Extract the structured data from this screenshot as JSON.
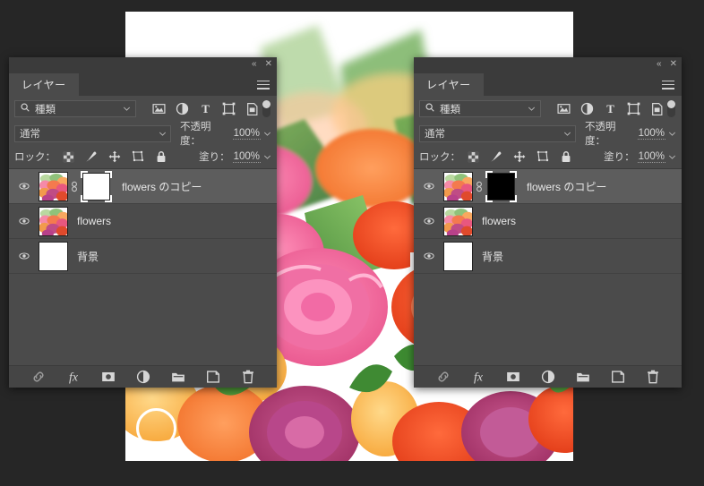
{
  "app": {
    "background_color": "#262626",
    "panel_bg": "#4b4b4b",
    "panel_header_bg": "#3b3b3b",
    "selected_row_bg": "#5d5d5d",
    "highlight_ring_color": "#ffffff"
  },
  "canvas": {
    "name": "flower-bouquet-photo",
    "description": "花束の写真",
    "arrow": "➡"
  },
  "panels": [
    {
      "id": "left",
      "titlebar": {
        "collapse": "«",
        "close": "✕"
      },
      "tab": {
        "label": "レイヤー",
        "menu_icon": "hamburger-icon"
      },
      "filter": {
        "search_icon": "search-icon",
        "kind_label": "種類",
        "chevron": "chevron-down-icon",
        "icons": [
          "image-filter-icon",
          "adjustment-filter-icon",
          "type-filter-icon",
          "shape-filter-icon",
          "smart-object-filter-icon"
        ],
        "toggle": "filter-toggle"
      },
      "blend": {
        "mode": "通常",
        "chevron": "chevron-down-icon",
        "opacity_label": "不透明度：",
        "opacity_value": "100%"
      },
      "lock": {
        "label": "ロック：",
        "icons": [
          "lock-transparency-icon",
          "lock-image-icon",
          "lock-position-icon",
          "lock-artboard-icon",
          "lock-all-icon"
        ],
        "fill_label": "塗り：",
        "fill_value": "100%"
      },
      "layers": [
        {
          "name": "flowers のコピー",
          "visible_icon": "eye-icon",
          "selected": true,
          "thumb": "photo",
          "has_link": true,
          "link_icon": "link-icon",
          "mask": {
            "present": true,
            "fill": "#ffffff",
            "selected": true
          }
        },
        {
          "name": "flowers",
          "visible_icon": "eye-icon",
          "selected": false,
          "thumb": "photo",
          "has_link": false,
          "mask": {
            "present": false
          }
        },
        {
          "name": "背景",
          "visible_icon": "eye-icon",
          "selected": false,
          "thumb": "white",
          "has_link": false,
          "mask": {
            "present": false
          }
        }
      ],
      "toolbar": [
        {
          "icon": "link-layers-icon",
          "label": "レイヤーをリンク",
          "highlighted": false
        },
        {
          "icon": "fx-icon",
          "label": "fx",
          "highlighted": false
        },
        {
          "icon": "add-layer-mask-icon",
          "label": "レイヤーマスクを追加",
          "highlighted": true
        },
        {
          "icon": "adjustment-layer-icon",
          "label": "調整レイヤー",
          "highlighted": false
        },
        {
          "icon": "new-group-icon",
          "label": "新規グループ",
          "highlighted": false
        },
        {
          "icon": "new-layer-icon",
          "label": "新規レイヤー",
          "highlighted": false
        },
        {
          "icon": "delete-layer-icon",
          "label": "レイヤーを削除",
          "highlighted": false
        }
      ]
    },
    {
      "id": "right",
      "titlebar": {
        "collapse": "«",
        "close": "✕"
      },
      "tab": {
        "label": "レイヤー",
        "menu_icon": "hamburger-icon"
      },
      "filter": {
        "search_icon": "search-icon",
        "kind_label": "種類",
        "chevron": "chevron-down-icon",
        "icons": [
          "image-filter-icon",
          "adjustment-filter-icon",
          "type-filter-icon",
          "shape-filter-icon",
          "smart-object-filter-icon"
        ],
        "toggle": "filter-toggle"
      },
      "blend": {
        "mode": "通常",
        "chevron": "chevron-down-icon",
        "opacity_label": "不透明度：",
        "opacity_value": "100%"
      },
      "lock": {
        "label": "ロック：",
        "icons": [
          "lock-transparency-icon",
          "lock-image-icon",
          "lock-position-icon",
          "lock-artboard-icon",
          "lock-all-icon"
        ],
        "fill_label": "塗り：",
        "fill_value": "100%"
      },
      "layers": [
        {
          "name": "flowers のコピー",
          "visible_icon": "eye-icon",
          "selected": true,
          "thumb": "photo",
          "has_link": true,
          "link_icon": "link-icon",
          "mask": {
            "present": true,
            "fill": "#000000",
            "selected": true
          }
        },
        {
          "name": "flowers",
          "visible_icon": "eye-icon",
          "selected": false,
          "thumb": "photo",
          "has_link": false,
          "mask": {
            "present": false
          }
        },
        {
          "name": "背景",
          "visible_icon": "eye-icon",
          "selected": false,
          "thumb": "white",
          "has_link": false,
          "mask": {
            "present": false
          }
        }
      ],
      "toolbar": [
        {
          "icon": "link-layers-icon",
          "label": "レイヤーをリンク",
          "highlighted": false
        },
        {
          "icon": "fx-icon",
          "label": "fx",
          "highlighted": false
        },
        {
          "icon": "add-layer-mask-icon",
          "label": "レイヤーマスクを追加",
          "highlighted": false
        },
        {
          "icon": "adjustment-layer-icon",
          "label": "調整レイヤー",
          "highlighted": false
        },
        {
          "icon": "new-group-icon",
          "label": "新規グループ",
          "highlighted": false
        },
        {
          "icon": "new-layer-icon",
          "label": "新規レイヤー",
          "highlighted": false
        },
        {
          "icon": "delete-layer-icon",
          "label": "レイヤーを削除",
          "highlighted": false
        }
      ]
    }
  ]
}
